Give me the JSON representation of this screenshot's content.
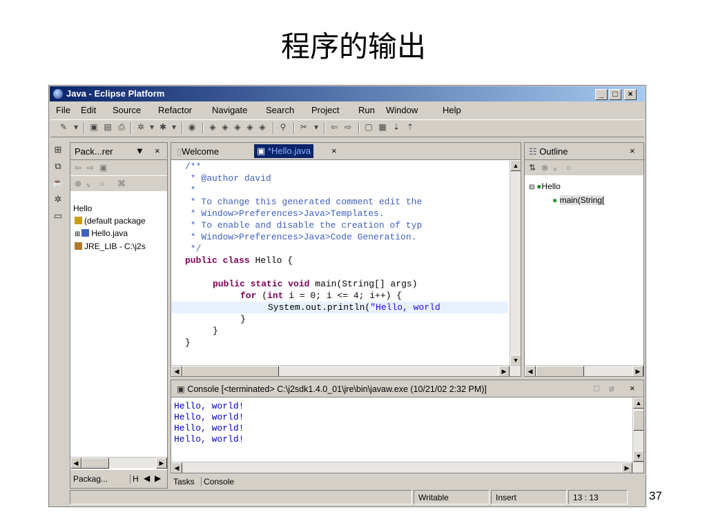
{
  "slide": {
    "title": "程序的输出",
    "page_number": "37"
  },
  "window": {
    "title": "Java - Eclipse Platform",
    "min": "_",
    "max": "□",
    "close": "×"
  },
  "menu": [
    "File",
    "Edit",
    "Source",
    "Refactor",
    "Navigate",
    "Search",
    "Project",
    "Run",
    "Window",
    "Help"
  ],
  "package_explorer": {
    "tab": "Pack...rer",
    "items": [
      "Hello",
      "(default package",
      "Hello.java",
      "JRE_LIB - C:\\j2s"
    ],
    "bottom_tabs": [
      "Packag...",
      "H"
    ]
  },
  "editor": {
    "tabs": [
      "Welcome",
      "*Hello.java"
    ],
    "lines": [
      "/**",
      " * @author david",
      " *",
      " * To change this generated comment edit the",
      " * Window>Preferences>Java>Templates.",
      " * To enable and disable the creation of typ",
      " * Window>Preferences>Java>Code Generation.",
      " */"
    ],
    "code": {
      "kw_public": "public",
      "kw_class": "class",
      "class_name": " Hello {",
      "kw_static": "static",
      "kw_void": "void",
      "main_sig": " main(String[] args)",
      "kw_for": "for",
      "kw_int": "int",
      "for_rest": " i = 0; i <= 4; i++) {",
      "print_call": "System.out.println(",
      "print_str": "\"Hello, world",
      "close1": "}",
      "close2": "}",
      "close3": "}"
    }
  },
  "outline": {
    "tab": "Outline",
    "items": [
      "Hello",
      "main(String["
    ]
  },
  "console": {
    "header": "Console [<terminated> C:\\j2sdk1.4.0_01\\jre\\bin\\javaw.exe (10/21/02 2:32 PM)]",
    "lines": [
      "Hello, world!",
      "Hello, world!",
      "Hello, world!",
      "Hello, world!"
    ]
  },
  "bottom_tabs": [
    "Tasks",
    "Console"
  ],
  "status": {
    "writable": "Writable",
    "insert": "Insert",
    "position": "13 : 13"
  },
  "colors": {
    "title_gradient_start": "#0a246a",
    "title_gradient_end": "#a6caf0",
    "chrome": "#d4d0c8",
    "comment": "#3f5fbf",
    "keyword": "#7f0055",
    "string": "#2a00ff",
    "console_text": "#0000c8"
  }
}
